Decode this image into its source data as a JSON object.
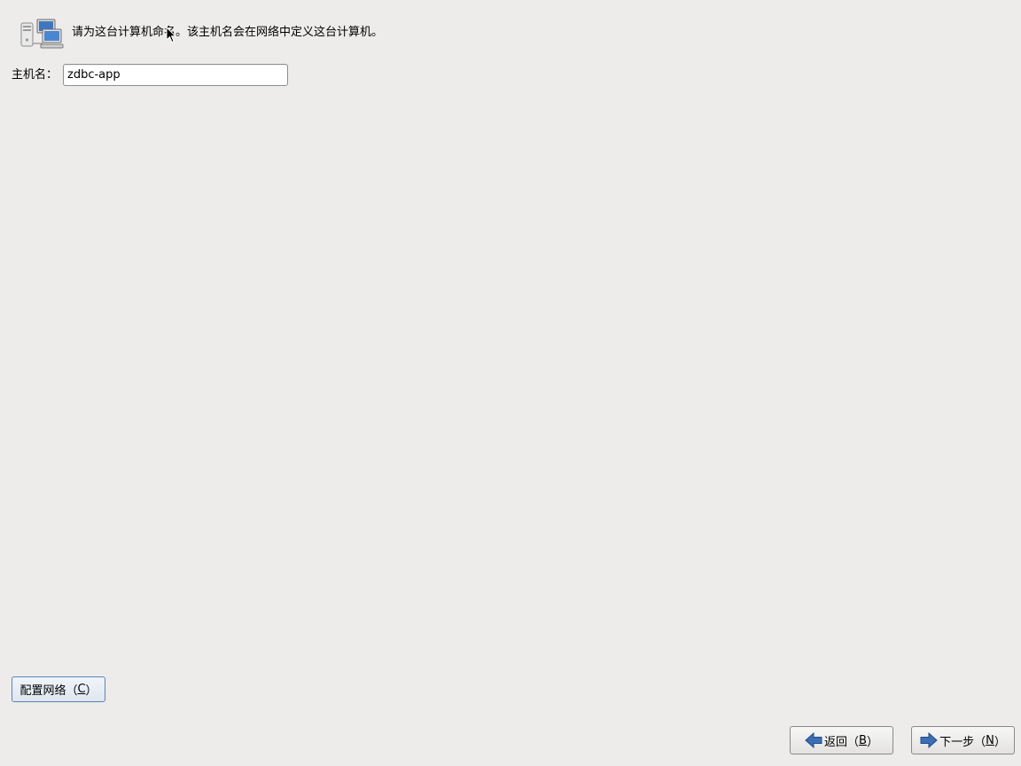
{
  "header": {
    "icon": "network-computers-icon",
    "text": "请为这台计算机命名。该主机名会在网络中定义这台计算机。"
  },
  "hostname": {
    "label": "主机名：",
    "value": "zdbc-app"
  },
  "buttons": {
    "configure_network": {
      "prefix": "配置网络（",
      "mnemonic": "C",
      "suffix": "）"
    },
    "back": {
      "icon": "arrow-left-icon",
      "prefix": "返回（",
      "mnemonic": "B",
      "suffix": "）"
    },
    "next": {
      "icon": "arrow-right-icon",
      "prefix": "下一步（",
      "mnemonic": "N",
      "suffix": "）"
    }
  },
  "colors": {
    "background": "#edeceb",
    "focus_border": "#5b84b9",
    "arrow_blue": "#3d6eb4"
  }
}
